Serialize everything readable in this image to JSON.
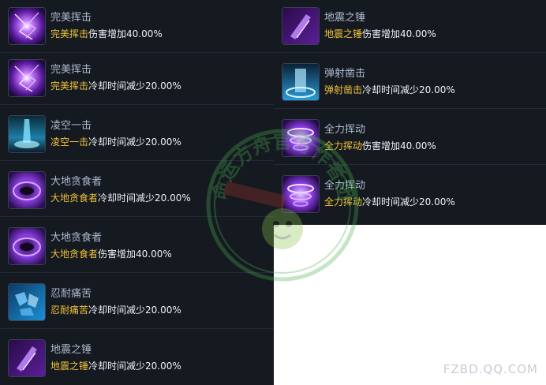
{
  "colors": {
    "panel_bg": "#151a21",
    "skill_name": "#aebad0",
    "highlight": "#f0c23a",
    "text": "#eef0f4"
  },
  "left_column": [
    {
      "name": "完美挥击",
      "desc_skill": "完美挥击",
      "desc_effect": "伤害增加40.00%",
      "icon": "purple-lightning-orb-icon"
    },
    {
      "name": "完美挥击",
      "desc_skill": "完美挥击",
      "desc_effect": "冷却时间减少20.00%",
      "icon": "purple-lightning-orb-icon"
    },
    {
      "name": "凌空一击",
      "desc_skill": "凌空一击",
      "desc_effect": "冷却时间减少20.00%",
      "icon": "cyan-impact-icon"
    },
    {
      "name": "大地贪食者",
      "desc_skill": "大地贪食者",
      "desc_effect": "冷却时间减少20.00%",
      "icon": "purple-vortex-icon"
    },
    {
      "name": "大地贪食者",
      "desc_skill": "大地贪食者",
      "desc_effect": "伤害增加40.00%",
      "icon": "purple-vortex-icon"
    },
    {
      "name": "忍耐痛苦",
      "desc_skill": "忍耐痛苦",
      "desc_effect": "冷却时间减少20.00%",
      "icon": "blue-shatter-icon"
    },
    {
      "name": "地震之锤",
      "desc_skill": "地震之锤",
      "desc_effect": "冷却时间减少20.00%",
      "icon": "purple-hammer-icon"
    }
  ],
  "right_column": [
    {
      "name": "地震之锤",
      "desc_skill": "地震之锤",
      "desc_effect": "伤害增加40.00%",
      "icon": "purple-hammer-icon"
    },
    {
      "name": "弹射凿击",
      "desc_skill": "弹射凿击",
      "desc_effect": "冷却时间减少20.00%",
      "icon": "blue-pillar-icon"
    },
    {
      "name": "全力挥动",
      "desc_skill": "全力挥动",
      "desc_effect": "伤害增加40.00%",
      "icon": "purple-whirlwind-icon"
    },
    {
      "name": "全力挥动",
      "desc_skill": "全力挥动",
      "desc_effect": "冷却时间减少20.00%",
      "icon": "purple-whirlwind-icon"
    }
  ],
  "watermark": {
    "text": "命运方舟官方作者团"
  },
  "site": {
    "text": "FZBD.QQ.COM"
  }
}
